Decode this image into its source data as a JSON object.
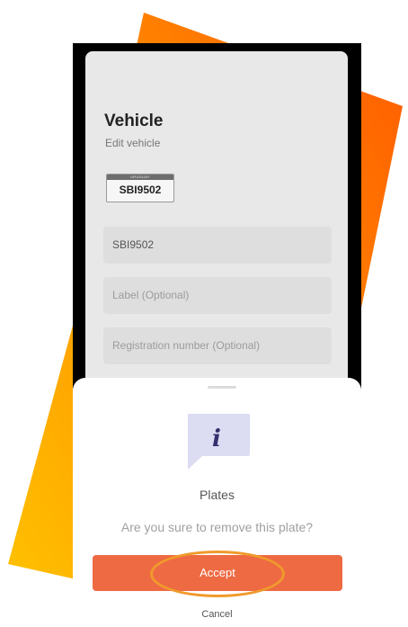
{
  "vehicle_screen": {
    "title": "Vehicle",
    "subtitle": "Edit vehicle",
    "plate_preview": {
      "country": "URUGUAY",
      "number": "SBI9502"
    },
    "fields": {
      "plate_value": "SBI9502",
      "label_placeholder": "Label (Optional)",
      "registration_placeholder": "Registration number (Optional)"
    }
  },
  "dialog": {
    "icon": "info-icon",
    "icon_glyph": "i",
    "title": "Plates",
    "message": "Are you sure to remove this plate?",
    "accept_label": "Accept",
    "cancel_label": "Cancel"
  },
  "colors": {
    "accent": "#ee6a43",
    "highlight_ring": "#f09a2c",
    "background_gradient_start": "#ffc400",
    "background_gradient_end": "#ff5a00",
    "icon_background": "#dcdcf2",
    "icon_glyph": "#34306e"
  }
}
